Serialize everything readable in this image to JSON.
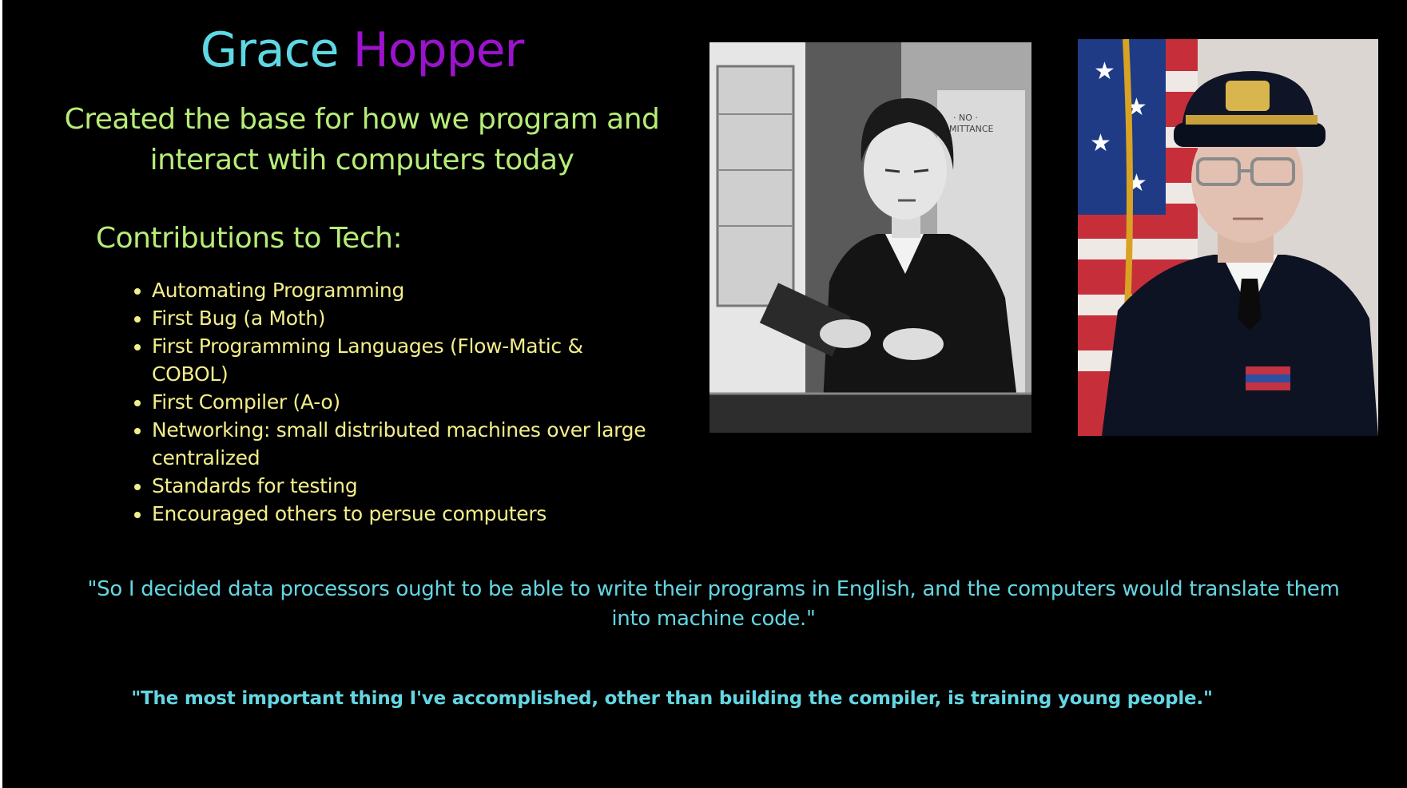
{
  "slide": {
    "title": {
      "first_name": "Grace",
      "last_name": "Hopper",
      "first_color": "#5ed8e4",
      "last_color": "#9b13cc"
    },
    "subtitle": "Created the base for how we program and interact wtih computers today",
    "contributions": {
      "heading": "Contributions to Tech:",
      "items": [
        "Automating Programming",
        "First Bug (a Moth)",
        "First Programming Languages (Flow-Matic & COBOL)",
        "First Compiler (A-o)",
        "Networking: small distributed machines over large centralized",
        "Standards for testing",
        "Encouraged others to persue computers"
      ]
    },
    "photos": [
      {
        "name": "young-grace-hopper-photo",
        "style": "black-and-white"
      },
      {
        "name": "admiral-grace-hopper-photo",
        "style": "color"
      }
    ],
    "quotes": [
      "\"So I decided data processors ought to be able to write their programs in English, and the computers would translate them into machine code.\"",
      "\"The most important thing I've accomplished, other than building the compiler, is training young people.\""
    ],
    "colors": {
      "background": "#000000",
      "subtitle": "#b6ec78",
      "list": "#f3ee8a",
      "quotes": "#63d6e2"
    }
  }
}
